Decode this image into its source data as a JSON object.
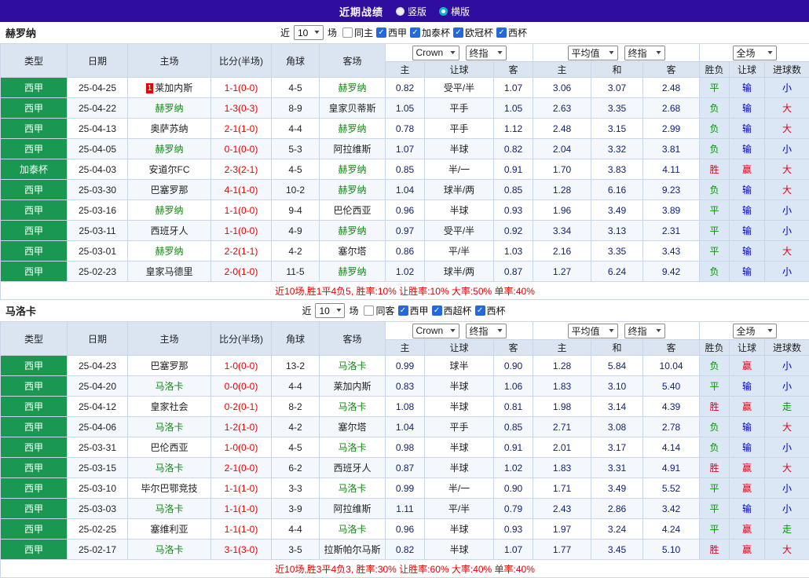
{
  "topbar": {
    "title": "近期战绩",
    "radios": [
      {
        "label": "竖版",
        "selected": false
      },
      {
        "label": "横版",
        "selected": true
      }
    ]
  },
  "filter_labels": {
    "near": "近",
    "games": "场"
  },
  "table_header": {
    "columns": [
      "类型",
      "日期",
      "主场",
      "比分(半场)",
      "角球",
      "客场"
    ],
    "odds_selects_1": [
      "Crown",
      "终指"
    ],
    "odds_selects_2": [
      "平均值",
      "终指"
    ],
    "scope_select": "全场",
    "subcolumns": [
      "主",
      "让球",
      "客",
      "主",
      "和",
      "客",
      "胜负",
      "让球",
      "进球数"
    ]
  },
  "result_colors": {
    "胜": "#e60012",
    "平": "#009900",
    "负": "#009900",
    "赢": "#e60012",
    "输": "#0000cc",
    "大": "#e60012",
    "小": "#0000cc",
    "走": "#009900"
  },
  "sections": [
    {
      "team": "赫罗纳",
      "near_count": "10",
      "checkboxes": [
        {
          "label": "同主",
          "checked": false
        },
        {
          "label": "西甲",
          "checked": true
        },
        {
          "label": "加泰杯",
          "checked": true
        },
        {
          "label": "欧冠杯",
          "checked": true
        },
        {
          "label": "西杯",
          "checked": true
        }
      ],
      "rows": [
        {
          "league": "西甲",
          "date": "25-04-25",
          "badge": "1",
          "home": "莱加内斯",
          "home_focus": false,
          "score": "1-1(0-0)",
          "corners": "4-5",
          "away": "赫罗纳",
          "away_focus": true,
          "crown_home": "0.82",
          "handicap": "受平/半",
          "crown_away": "1.07",
          "avg_home": "3.06",
          "avg_draw": "3.07",
          "avg_away": "2.48",
          "result": "平",
          "handicap_result": "输",
          "goals": "小"
        },
        {
          "league": "西甲",
          "date": "25-04-22",
          "badge": "",
          "home": "赫罗纳",
          "home_focus": true,
          "score": "1-3(0-3)",
          "corners": "8-9",
          "away": "皇家贝蒂斯",
          "away_focus": false,
          "crown_home": "1.05",
          "handicap": "平手",
          "crown_away": "1.05",
          "avg_home": "2.63",
          "avg_draw": "3.35",
          "avg_away": "2.68",
          "result": "负",
          "handicap_result": "输",
          "goals": "大"
        },
        {
          "league": "西甲",
          "date": "25-04-13",
          "badge": "",
          "home": "奥萨苏纳",
          "home_focus": false,
          "score": "2-1(1-0)",
          "corners": "4-4",
          "away": "赫罗纳",
          "away_focus": true,
          "crown_home": "0.78",
          "handicap": "平手",
          "crown_away": "1.12",
          "avg_home": "2.48",
          "avg_draw": "3.15",
          "avg_away": "2.99",
          "result": "负",
          "handicap_result": "输",
          "goals": "大"
        },
        {
          "league": "西甲",
          "date": "25-04-05",
          "badge": "",
          "home": "赫罗纳",
          "home_focus": true,
          "score": "0-1(0-0)",
          "corners": "5-3",
          "away": "阿拉维斯",
          "away_focus": false,
          "crown_home": "1.07",
          "handicap": "半球",
          "crown_away": "0.82",
          "avg_home": "2.04",
          "avg_draw": "3.32",
          "avg_away": "3.81",
          "result": "负",
          "handicap_result": "输",
          "goals": "小"
        },
        {
          "league": "加泰杯",
          "date": "25-04-03",
          "badge": "",
          "home": "安道尔FC",
          "home_focus": false,
          "score": "2-3(2-1)",
          "corners": "4-5",
          "away": "赫罗纳",
          "away_focus": true,
          "crown_home": "0.85",
          "handicap": "半/一",
          "crown_away": "0.91",
          "avg_home": "1.70",
          "avg_draw": "3.83",
          "avg_away": "4.11",
          "result": "胜",
          "handicap_result": "赢",
          "goals": "大"
        },
        {
          "league": "西甲",
          "date": "25-03-30",
          "badge": "",
          "home": "巴塞罗那",
          "home_focus": false,
          "score": "4-1(1-0)",
          "corners": "10-2",
          "away": "赫罗纳",
          "away_focus": true,
          "crown_home": "1.04",
          "handicap": "球半/两",
          "crown_away": "0.85",
          "avg_home": "1.28",
          "avg_draw": "6.16",
          "avg_away": "9.23",
          "result": "负",
          "handicap_result": "输",
          "goals": "大"
        },
        {
          "league": "西甲",
          "date": "25-03-16",
          "badge": "",
          "home": "赫罗纳",
          "home_focus": true,
          "score": "1-1(0-0)",
          "corners": "9-4",
          "away": "巴伦西亚",
          "away_focus": false,
          "crown_home": "0.96",
          "handicap": "半球",
          "crown_away": "0.93",
          "avg_home": "1.96",
          "avg_draw": "3.49",
          "avg_away": "3.89",
          "result": "平",
          "handicap_result": "输",
          "goals": "小"
        },
        {
          "league": "西甲",
          "date": "25-03-11",
          "badge": "",
          "home": "西班牙人",
          "home_focus": false,
          "score": "1-1(0-0)",
          "corners": "4-9",
          "away": "赫罗纳",
          "away_focus": true,
          "crown_home": "0.97",
          "handicap": "受平/半",
          "crown_away": "0.92",
          "avg_home": "3.34",
          "avg_draw": "3.13",
          "avg_away": "2.31",
          "result": "平",
          "handicap_result": "输",
          "goals": "小"
        },
        {
          "league": "西甲",
          "date": "25-03-01",
          "badge": "",
          "home": "赫罗纳",
          "home_focus": true,
          "score": "2-2(1-1)",
          "corners": "4-2",
          "away": "塞尔塔",
          "away_focus": false,
          "crown_home": "0.86",
          "handicap": "平/半",
          "crown_away": "1.03",
          "avg_home": "2.16",
          "avg_draw": "3.35",
          "avg_away": "3.43",
          "result": "平",
          "handicap_result": "输",
          "goals": "大"
        },
        {
          "league": "西甲",
          "date": "25-02-23",
          "badge": "",
          "home": "皇家马德里",
          "home_focus": false,
          "score": "2-0(1-0)",
          "corners": "11-5",
          "away": "赫罗纳",
          "away_focus": true,
          "crown_home": "1.02",
          "handicap": "球半/两",
          "crown_away": "0.87",
          "avg_home": "1.27",
          "avg_draw": "6.24",
          "avg_away": "9.42",
          "result": "负",
          "handicap_result": "输",
          "goals": "小"
        }
      ],
      "summary": "近10场,胜1平4负5, 胜率:10% 让胜率:10% 大率:50% 单率:40%"
    },
    {
      "team": "马洛卡",
      "near_count": "10",
      "checkboxes": [
        {
          "label": "同客",
          "checked": false
        },
        {
          "label": "西甲",
          "checked": true
        },
        {
          "label": "西超杯",
          "checked": true
        },
        {
          "label": "西杯",
          "checked": true
        }
      ],
      "rows": [
        {
          "league": "西甲",
          "date": "25-04-23",
          "badge": "",
          "home": "巴塞罗那",
          "home_focus": false,
          "score": "1-0(0-0)",
          "corners": "13-2",
          "away": "马洛卡",
          "away_focus": true,
          "crown_home": "0.99",
          "handicap": "球半",
          "crown_away": "0.90",
          "avg_home": "1.28",
          "avg_draw": "5.84",
          "avg_away": "10.04",
          "result": "负",
          "handicap_result": "赢",
          "goals": "小"
        },
        {
          "league": "西甲",
          "date": "25-04-20",
          "badge": "",
          "home": "马洛卡",
          "home_focus": true,
          "score": "0-0(0-0)",
          "corners": "4-4",
          "away": "莱加内斯",
          "away_focus": false,
          "crown_home": "0.83",
          "handicap": "半球",
          "crown_away": "1.06",
          "avg_home": "1.83",
          "avg_draw": "3.10",
          "avg_away": "5.40",
          "result": "平",
          "handicap_result": "输",
          "goals": "小"
        },
        {
          "league": "西甲",
          "date": "25-04-12",
          "badge": "",
          "home": "皇家社会",
          "home_focus": false,
          "score": "0-2(0-1)",
          "corners": "8-2",
          "away": "马洛卡",
          "away_focus": true,
          "crown_home": "1.08",
          "handicap": "半球",
          "crown_away": "0.81",
          "avg_home": "1.98",
          "avg_draw": "3.14",
          "avg_away": "4.39",
          "result": "胜",
          "handicap_result": "赢",
          "goals": "走"
        },
        {
          "league": "西甲",
          "date": "25-04-06",
          "badge": "",
          "home": "马洛卡",
          "home_focus": true,
          "score": "1-2(1-0)",
          "corners": "4-2",
          "away": "塞尔塔",
          "away_focus": false,
          "crown_home": "1.04",
          "handicap": "平手",
          "crown_away": "0.85",
          "avg_home": "2.71",
          "avg_draw": "3.08",
          "avg_away": "2.78",
          "result": "负",
          "handicap_result": "输",
          "goals": "大"
        },
        {
          "league": "西甲",
          "date": "25-03-31",
          "badge": "",
          "home": "巴伦西亚",
          "home_focus": false,
          "score": "1-0(0-0)",
          "corners": "4-5",
          "away": "马洛卡",
          "away_focus": true,
          "crown_home": "0.98",
          "handicap": "半球",
          "crown_away": "0.91",
          "avg_home": "2.01",
          "avg_draw": "3.17",
          "avg_away": "4.14",
          "result": "负",
          "handicap_result": "输",
          "goals": "小"
        },
        {
          "league": "西甲",
          "date": "25-03-15",
          "badge": "",
          "home": "马洛卡",
          "home_focus": true,
          "score": "2-1(0-0)",
          "corners": "6-2",
          "away": "西班牙人",
          "away_focus": false,
          "crown_home": "0.87",
          "handicap": "半球",
          "crown_away": "1.02",
          "avg_home": "1.83",
          "avg_draw": "3.31",
          "avg_away": "4.91",
          "result": "胜",
          "handicap_result": "赢",
          "goals": "大"
        },
        {
          "league": "西甲",
          "date": "25-03-10",
          "badge": "",
          "home": "毕尔巴鄂竞技",
          "home_focus": false,
          "score": "1-1(1-0)",
          "corners": "3-3",
          "away": "马洛卡",
          "away_focus": true,
          "crown_home": "0.99",
          "handicap": "半/一",
          "crown_away": "0.90",
          "avg_home": "1.71",
          "avg_draw": "3.49",
          "avg_away": "5.52",
          "result": "平",
          "handicap_result": "赢",
          "goals": "小"
        },
        {
          "league": "西甲",
          "date": "25-03-03",
          "badge": "",
          "home": "马洛卡",
          "home_focus": true,
          "score": "1-1(1-0)",
          "corners": "3-9",
          "away": "阿拉维斯",
          "away_focus": false,
          "crown_home": "1.11",
          "handicap": "平/半",
          "crown_away": "0.79",
          "avg_home": "2.43",
          "avg_draw": "2.86",
          "avg_away": "3.42",
          "result": "平",
          "handicap_result": "输",
          "goals": "小"
        },
        {
          "league": "西甲",
          "date": "25-02-25",
          "badge": "",
          "home": "塞维利亚",
          "home_focus": false,
          "score": "1-1(1-0)",
          "corners": "4-4",
          "away": "马洛卡",
          "away_focus": true,
          "crown_home": "0.96",
          "handicap": "半球",
          "crown_away": "0.93",
          "avg_home": "1.97",
          "avg_draw": "3.24",
          "avg_away": "4.24",
          "result": "平",
          "handicap_result": "赢",
          "goals": "走"
        },
        {
          "league": "西甲",
          "date": "25-02-17",
          "badge": "",
          "home": "马洛卡",
          "home_focus": true,
          "score": "3-1(3-0)",
          "corners": "3-5",
          "away": "拉斯帕尔马斯",
          "away_focus": false,
          "crown_home": "0.82",
          "handicap": "半球",
          "crown_away": "1.07",
          "avg_home": "1.77",
          "avg_draw": "3.45",
          "avg_away": "5.10",
          "result": "胜",
          "handicap_result": "赢",
          "goals": "大"
        }
      ],
      "summary": "近10场,胜3平4负3, 胜率:30% 让胜率:60% 大率:40% 单率:40%"
    }
  ]
}
